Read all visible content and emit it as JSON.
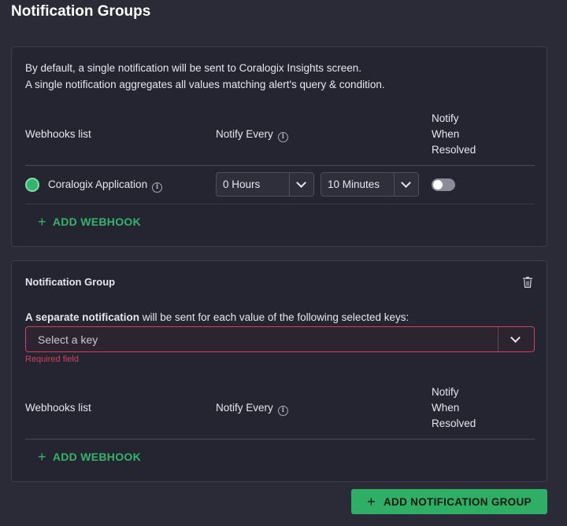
{
  "page": {
    "title": "Notification Groups"
  },
  "default_card": {
    "info_line1": "By default, a single notification will be sent to Coralogix Insights screen.",
    "info_line2": "A single notification aggregates all values matching alert's query & condition.",
    "columns": {
      "webhooks": "Webhooks list",
      "notify_every": "Notify Every",
      "resolved_line1": "Notify",
      "resolved_line2": "When",
      "resolved_line3": "Resolved"
    },
    "rows": [
      {
        "name": "Coralogix Application",
        "hours": "0 Hours",
        "minutes": "10 Minutes",
        "notify_when_resolved": false
      }
    ],
    "add_webhook": "ADD WEBHOOK"
  },
  "group_card": {
    "title": "Notification Group",
    "key_label_bold": "A separate notification",
    "key_label_rest": " will be sent for each value of the following selected keys:",
    "key_placeholder": "Select a key",
    "error": "Required field",
    "columns": {
      "webhooks": "Webhooks list",
      "notify_every": "Notify Every",
      "resolved_line1": "Notify",
      "resolved_line2": "When",
      "resolved_line3": "Resolved"
    },
    "add_webhook": "ADD WEBHOOK"
  },
  "add_group_button": "ADD NOTIFICATION GROUP",
  "icons": {
    "info": "info-icon",
    "chevron": "chevron-down-icon",
    "trash": "trash-icon",
    "plus": "plus-icon"
  },
  "colors": {
    "background": "#2b2b37",
    "card": "#252531",
    "accent_green": "#34b36c",
    "error_red": "#d0415c"
  }
}
